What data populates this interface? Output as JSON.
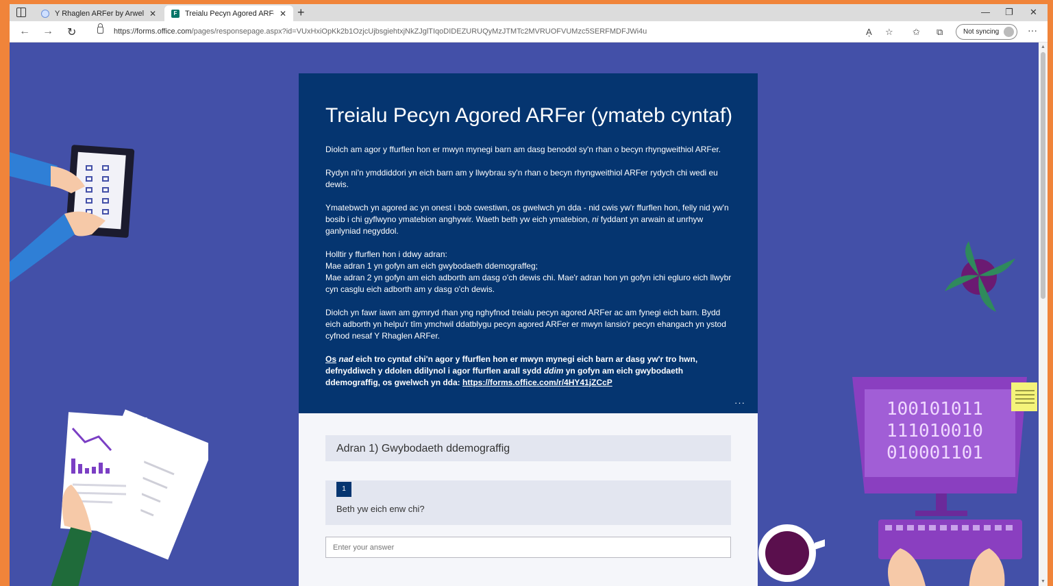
{
  "browser": {
    "tabs": [
      {
        "title": "Y Rhaglen ARFer by Arwel Willia",
        "active": false
      },
      {
        "title": "Treialu Pecyn Agored ARFer (ym",
        "active": true
      }
    ],
    "new_tab": "+",
    "url_host": "https://forms.office.com",
    "url_path": "/pages/responsepage.aspx?id=VUxHxiOpKk2b1OzjcUjbsgiehtxjNkZJglTIqoDIDEZURUQyMzJTMTc2MVRUOFVUMzc5SERFMDFJWi4u",
    "sync_label": "Not syncing",
    "more": "···",
    "window_controls": {
      "minimize": "—",
      "maximize": "❐",
      "close": "✕"
    },
    "nav": {
      "back": "←",
      "forward": "→",
      "reload": "↻"
    },
    "icons": {
      "read_aloud": "Aͅ",
      "favorite": "☆",
      "favorites_bar": "✩",
      "collections": "⧉"
    }
  },
  "form": {
    "title": "Treialu Pecyn Agored ARFer (ymateb cyntaf)",
    "intro_1": "Diolch am agor y ffurflen hon er mwyn mynegi barn am dasg benodol sy'n rhan o becyn rhyngweithiol ARFer.",
    "intro_2": "Rydyn ni'n ymddiddori yn eich barn am y llwybrau sy'n rhan o becyn rhyngweithiol ARFer rydych chi wedi eu dewis.",
    "intro_3a": "Ymatebwch yn agored ac yn onest i bob cwestiwn, os gwelwch yn dda - nid cwis yw'r ffurflen hon, felly nid yw'n bosib i chi gyflwyno ymatebion anghywir. Waeth beth yw eich ymatebion, ",
    "intro_3em": "ni",
    "intro_3b": " fyddant yn arwain at unrhyw ganlyniad negyddol.",
    "sections_line_1": "Holltir y ffurflen hon i ddwy adran:",
    "sections_line_2": "Mae adran 1 yn gofyn am eich gwybodaeth ddemograffeg;",
    "sections_line_3": "Mae adran 2 yn gofyn am eich adborth am dasg o'ch dewis chi. Mae'r adran hon yn gofyn ichi egluro eich llwybr cyn casglu eich adborth am y dasg o'ch dewis.",
    "thanks": "Diolch yn fawr iawn am gymryd rhan yng nghyfnod treialu pecyn agored ARFer ac am fynegi eich barn. Bydd eich adborth yn helpu'r tîm ymchwil ddatblygu pecyn agored ARFer er mwyn lansio'r pecyn ehangach yn ystod cyfnod nesaf Y Rhaglen ARFer.",
    "note_os": "Os",
    "note_nad": "nad",
    "note_a": " eich tro cyntaf chi'n agor y ffurflen hon er mwyn mynegi eich barn ar dasg yw'r tro hwn, defnyddiwch y ddolen ddilynol i agor ffurflen arall sydd ",
    "note_ddim": "ddim",
    "note_b": " yn gofyn am eich gwybodaeth ddemograffig, os gwelwch yn dda: ",
    "note_link": "https://forms.office.com/r/4HY41jZCcP",
    "header_more": "···",
    "section_title": "Adran 1) Gwybodaeth ddemograffig",
    "question_number": "1",
    "question_text": "Beth yw eich enw chi?",
    "answer_placeholder": "Enter your answer"
  },
  "decor": {
    "binary_1": "100101011",
    "binary_2": "111010010",
    "binary_3": "010001101"
  },
  "colors": {
    "page_bg": "#4350a8",
    "header_bg": "#053570",
    "frame": "#f0843a"
  }
}
